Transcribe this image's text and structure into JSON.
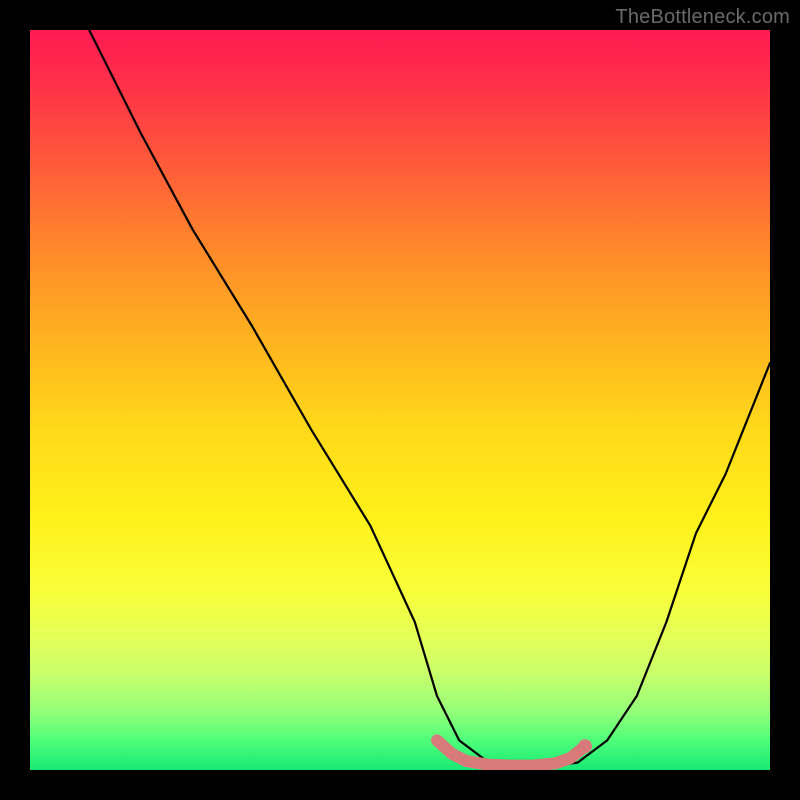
{
  "watermark": "TheBottleneck.com",
  "chart_data": {
    "type": "line",
    "title": "",
    "xlabel": "",
    "ylabel": "",
    "xlim": [
      0,
      100
    ],
    "ylim": [
      0,
      100
    ],
    "series": [
      {
        "name": "bottleneck-curve",
        "x": [
          8,
          15,
          22,
          30,
          38,
          46,
          52,
          55,
          58,
          62,
          66,
          70,
          74,
          78,
          82,
          86,
          90,
          94,
          100
        ],
        "values": [
          100,
          86,
          73,
          60,
          46,
          33,
          20,
          10,
          4,
          1,
          0.5,
          0.5,
          1,
          4,
          10,
          20,
          32,
          40,
          55
        ]
      },
      {
        "name": "optimal-range-marker",
        "x": [
          55,
          57,
          59,
          62,
          65,
          68,
          71,
          73,
          75
        ],
        "values": [
          4.0,
          2.2,
          1.2,
          0.7,
          0.6,
          0.6,
          0.9,
          1.6,
          3.2
        ]
      }
    ],
    "marker_point": {
      "x": 75,
      "y": 3.2
    },
    "colors": {
      "curve": "#000000",
      "marker": "#d97a7a",
      "gradient_top": "#ff1a52",
      "gradient_bottom": "#17e874"
    }
  }
}
